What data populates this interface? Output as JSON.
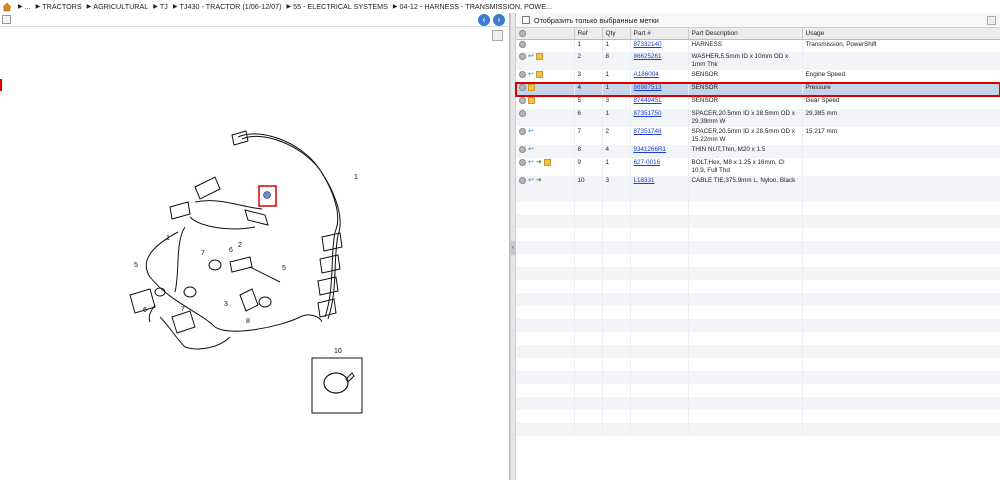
{
  "breadcrumb": {
    "items": [
      "...",
      "TRACTORS",
      "AGRICULTURAL",
      "TJ",
      "TJ430 - TRACTOR (1/06-12/07)",
      "55 - ELECTRICAL SYSTEMS",
      "04-12 - HARNESS - TRANSMISSION, POWE..."
    ]
  },
  "filter": {
    "label": "Отобразить только выбранные метки"
  },
  "table": {
    "headers": [
      "Ref",
      "Qty",
      "Part #",
      "Part Description",
      "Usage"
    ],
    "rows": [
      {
        "ref": "1",
        "qty": "1",
        "part": "87332140",
        "desc": "HARNESS",
        "usage": "Transmission, PowerShift",
        "icons": []
      },
      {
        "ref": "2",
        "qty": "8",
        "part": "86625261",
        "desc": "WASHER,5.5mm ID x 10mm OD x 1mm Thk",
        "usage": "",
        "icons": [
          "back",
          "box"
        ]
      },
      {
        "ref": "3",
        "qty": "1",
        "part": "A186004",
        "desc": "SENSOR",
        "usage": "Engine Speed",
        "icons": [
          "back",
          "box"
        ]
      },
      {
        "ref": "4",
        "qty": "1",
        "part": "86987513",
        "desc": "SENSOR",
        "usage": "Pressure",
        "icons": [
          "box"
        ]
      },
      {
        "ref": "5",
        "qty": "3",
        "part": "87449451",
        "desc": "SENSOR",
        "usage": "Gear Speed",
        "icons": [
          "box"
        ]
      },
      {
        "ref": "6",
        "qty": "1",
        "part": "87351750",
        "desc": "SPACER,20.5mm ID x 28.5mm OD x 29.39mm W",
        "usage": "29.385 mm",
        "icons": []
      },
      {
        "ref": "7",
        "qty": "2",
        "part": "87351748",
        "desc": "SPACER,20.5mm ID x 28.5mm OD x 15.22mm W",
        "usage": "15.217 mm",
        "icons": [
          "back"
        ]
      },
      {
        "ref": "8",
        "qty": "4",
        "part": "9341266R1",
        "desc": "THIN NUT,Thin, M20 x 1.5",
        "usage": "",
        "icons": [
          "back"
        ]
      },
      {
        "ref": "9",
        "qty": "1",
        "part": "627-0016",
        "desc": "BOLT,Hex, M8 x 1.25 x 16mm, Cl 10.9, Full Thd",
        "usage": "",
        "icons": [
          "back",
          "grn",
          "box"
        ]
      },
      {
        "ref": "10",
        "qty": "3",
        "part": "L18331",
        "desc": "CABLE TIE,375.9mm L, Nylon, Black",
        "usage": "",
        "icons": [
          "back",
          "grn"
        ]
      }
    ],
    "selected_ref": "4"
  },
  "diagram": {
    "callouts": [
      "1",
      "1",
      "2",
      "5",
      "5",
      "6",
      "7",
      "7",
      "3",
      "8",
      "6",
      "10"
    ]
  },
  "colors": {
    "accent": "#3b7bd0",
    "highlight": "#d00000",
    "link": "#1a3fd1",
    "selected_row": "#c5d4e6"
  }
}
